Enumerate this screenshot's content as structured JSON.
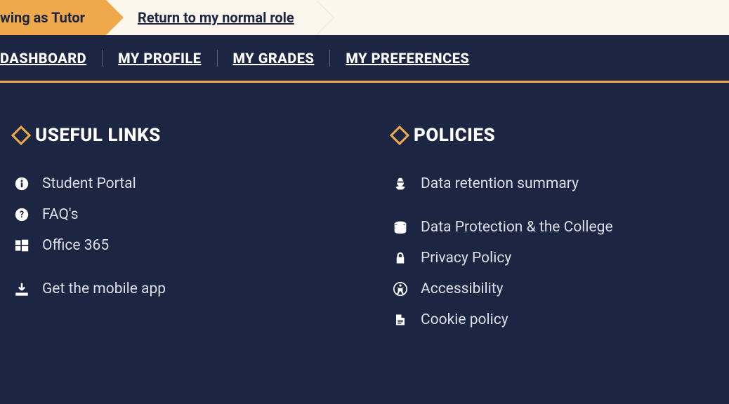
{
  "role_banner": {
    "viewing_as": "wing as Tutor",
    "return_label": "Return to my normal role"
  },
  "nav": {
    "items": [
      {
        "label": "DASHBOARD"
      },
      {
        "label": "MY PROFILE"
      },
      {
        "label": "MY GRADES"
      },
      {
        "label": "MY PREFERENCES"
      }
    ]
  },
  "footer": {
    "useful_links": {
      "title": "USEFUL LINKS",
      "items": [
        {
          "label": "Student Portal"
        },
        {
          "label": "FAQ's"
        },
        {
          "label": "Office 365"
        },
        {
          "label": "Get the mobile app"
        }
      ]
    },
    "policies": {
      "title": "POLICIES",
      "items": [
        {
          "label": "Data retention summary"
        },
        {
          "label": "Data Protection & the College"
        },
        {
          "label": "Privacy Policy"
        },
        {
          "label": "Accessibility"
        },
        {
          "label": "Cookie policy"
        }
      ]
    }
  }
}
